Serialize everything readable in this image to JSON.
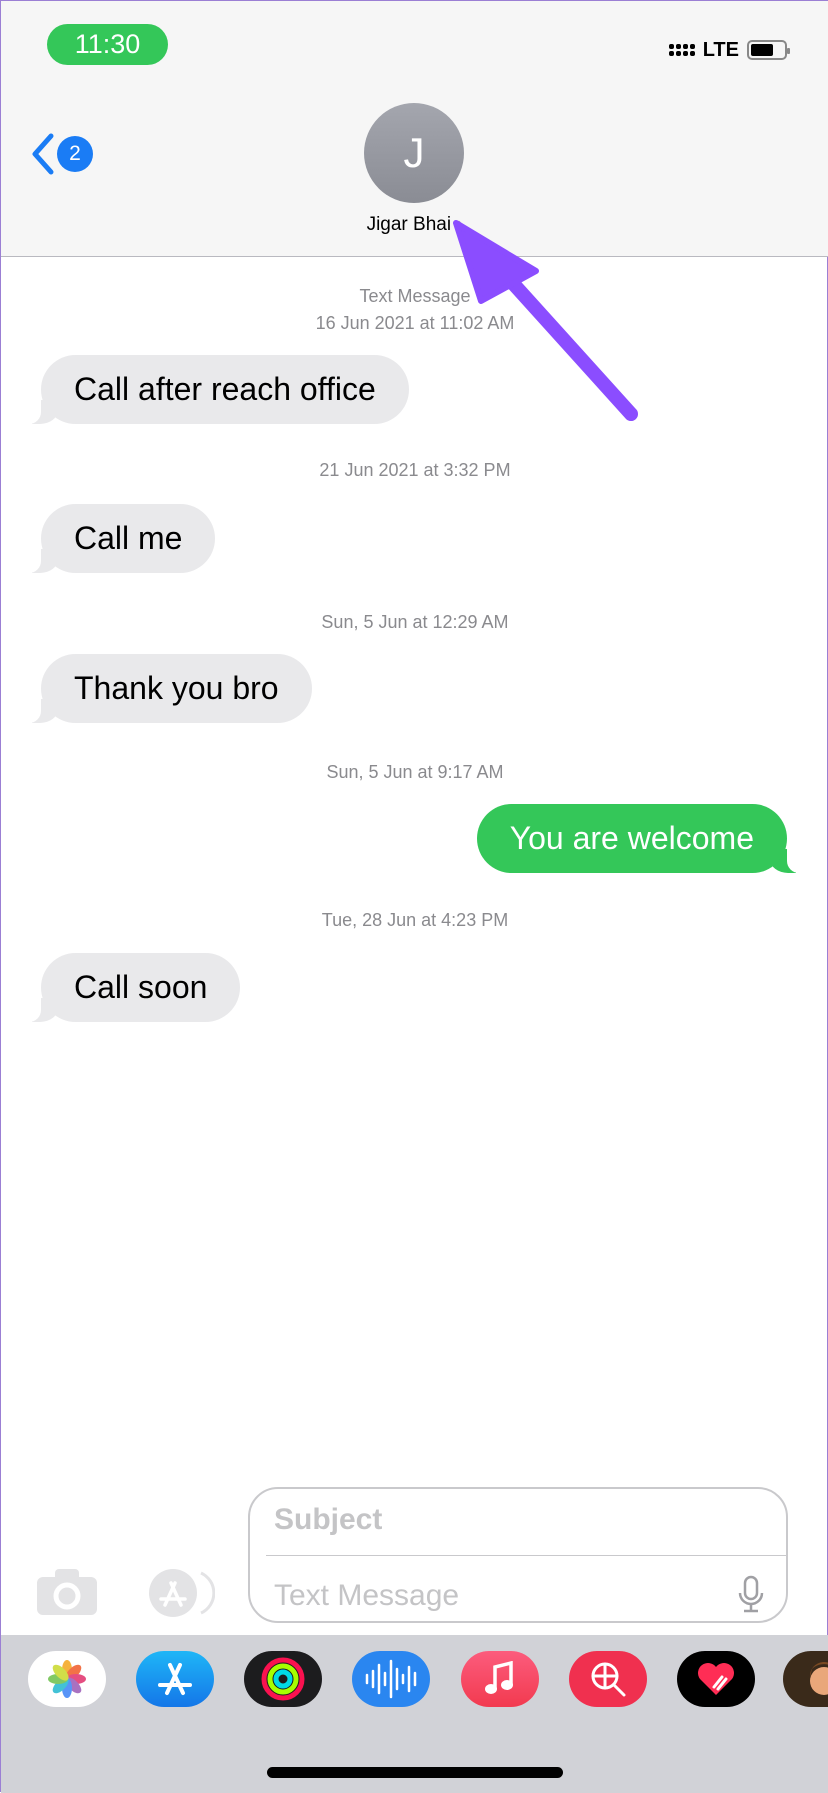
{
  "status_bar": {
    "time": "11:30",
    "network": "LTE"
  },
  "header": {
    "back_badge": "2",
    "avatar_initial": "J",
    "contact_name": "Jigar Bhai",
    "chevron": "›"
  },
  "thread": {
    "service_label": "Text Message",
    "items": [
      {
        "timestamp": "16 Jun 2021 at 11:02 AM",
        "text": "Call after reach office",
        "direction": "incoming"
      },
      {
        "timestamp": "21 Jun 2021 at 3:32 PM",
        "text": "Call me",
        "direction": "incoming"
      },
      {
        "timestamp": "Sun, 5 Jun at 12:29 AM",
        "text": "Thank you bro",
        "direction": "incoming"
      },
      {
        "timestamp": "Sun, 5 Jun at 9:17 AM",
        "text": "You are welcome",
        "direction": "outgoing"
      },
      {
        "timestamp": "Tue, 28 Jun at 4:23 PM",
        "text": "Call soon",
        "direction": "incoming"
      }
    ]
  },
  "composer": {
    "subject_placeholder": "Subject",
    "message_placeholder": "Text Message"
  },
  "app_tray": [
    "photos",
    "app-store",
    "activity",
    "audio-message",
    "music",
    "web-search",
    "digital-touch",
    "memoji"
  ],
  "colors": {
    "sent": "#34c759",
    "received": "#e9e9eb",
    "accent": "#1a7cf5",
    "annotation_arrow": "#8b4dff"
  }
}
